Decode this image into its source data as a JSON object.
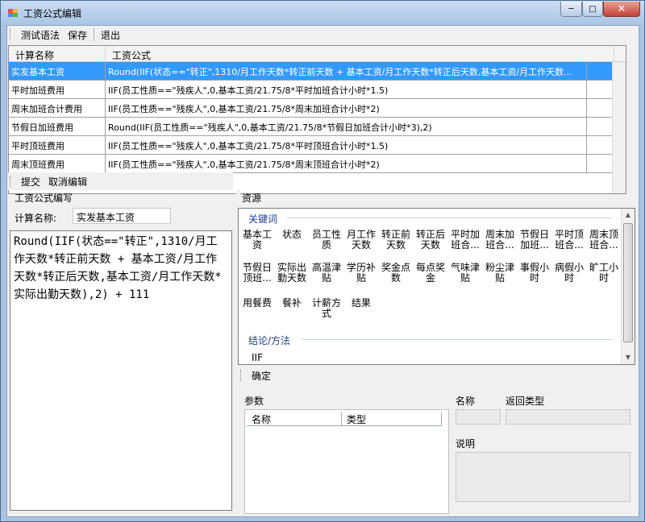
{
  "window": {
    "title": "工资公式编辑",
    "minimize_label": "─",
    "maximize_label": "□",
    "close_label": "✕"
  },
  "top_toolbar": {
    "test_syntax": "测试语法",
    "save": "保存",
    "exit": "退出"
  },
  "grid": {
    "columns": [
      "计算名称",
      "工资公式"
    ],
    "rows": [
      {
        "name": "实发基本工资",
        "formula": "Round(IIF(状态==\"转正\",1310/月工作天数*转正前天数 + 基本工资/月工作天数*转正后天数,基本工资/月工作天数...",
        "selected": true
      },
      {
        "name": "平时加班费用",
        "formula": "IIF(员工性质==\"残疾人\",0,基本工资/21.75/8*平时加班合计小时*1.5)"
      },
      {
        "name": "周末加班合计费用",
        "formula": "IIF(员工性质==\"残疾人\",0,基本工资/21.75/8*周末加班合计小时*2)"
      },
      {
        "name": "节假日加班费用",
        "formula": "Round(IIF(员工性质==\"残疾人\",0,基本工资/21.75/8*节假日加班合计小时*3),2)"
      },
      {
        "name": "平时顶班费用",
        "formula": "IIF(员工性质==\"残疾人\",0,基本工资/21.75/8*平时顶班合计小时*1.5)"
      },
      {
        "name": "周末顶班费用",
        "formula": "IIF(员工性质==\"残疾人\",0,基本工资/21.75/8*周末顶班合计小时*2)"
      }
    ]
  },
  "edit_toolbar": {
    "submit": "提交",
    "cancel_edit": "取消编辑"
  },
  "formula_group": {
    "title": "工资公式编写",
    "name_label": "计算名称:",
    "name_value": "实发基本工资",
    "formula_text": "Round(IIF(状态==\"转正\",1310/月工作天数*转正前天数 + 基本工资/月工作天数*转正后天数,基本工资/月工作天数*实际出勤天数),2) + 111"
  },
  "resources": {
    "title": "资源",
    "keywords_title": "关键词",
    "keywords": [
      "基本工资",
      "状态",
      "员工性质",
      "月工作天数",
      "转正前天数",
      "转正后天数",
      "平时加班合...",
      "周末加班合...",
      "节假日加班...",
      "平时顶班合...",
      "周末顶班合...",
      "节假日顶班...",
      "实际出勤天数",
      "高温津贴",
      "学历补贴",
      "奖金点数",
      "每点奖金",
      "气味津贴",
      "粉尘津贴",
      "事假小时",
      "病假小时",
      "旷工小时",
      "用餐费",
      "餐补",
      "计薪方式",
      "结果"
    ],
    "conclusion_title": "结论/方法",
    "functions": [
      "IIF"
    ]
  },
  "confirm_toolbar": {
    "confirm": "确定"
  },
  "params": {
    "title": "参数",
    "columns": [
      "名称",
      "类型"
    ],
    "name_label": "名称",
    "return_type_label": "返回类型",
    "description_label": "说明"
  }
}
